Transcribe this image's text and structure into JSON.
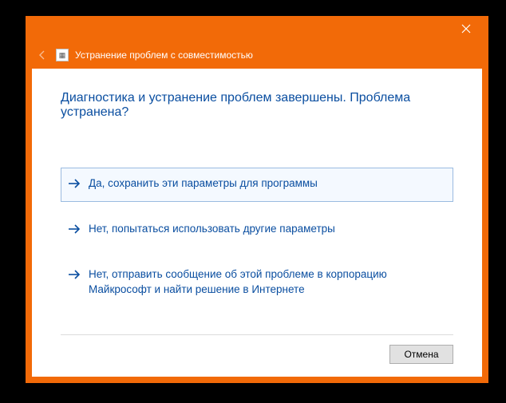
{
  "header": {
    "title": "Устранение проблем с совместимостью"
  },
  "main": {
    "heading": "Диагностика и устранение проблем завершены. Проблема устранена?",
    "options": [
      {
        "label": "Да, сохранить эти параметры для программы",
        "selected": true
      },
      {
        "label": "Нет, попытаться использовать другие параметры",
        "selected": false
      },
      {
        "label": "Нет, отправить сообщение об этой проблеме в корпорацию Майкрософт и найти решение в Интернете",
        "selected": false
      }
    ]
  },
  "footer": {
    "cancel_label": "Отмена"
  }
}
